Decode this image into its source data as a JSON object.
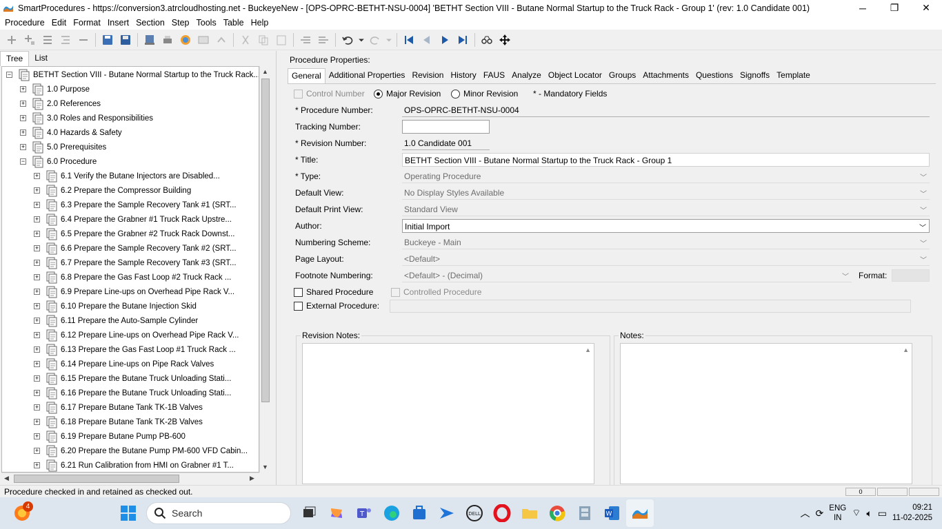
{
  "window": {
    "title": "SmartProcedures - https://conversion3.atrcloudhosting.net - BuckeyeNew - [OPS-OPRC-BETHT-NSU-0004] 'BETHT Section VIII - Butane Normal Startup to the Truck Rack - Group 1' (rev: 1.0 Candidate 001)"
  },
  "menu": [
    "Procedure",
    "Edit",
    "Format",
    "Insert",
    "Section",
    "Step",
    "Tools",
    "Table",
    "Help"
  ],
  "left_tabs": [
    "Tree",
    "List"
  ],
  "tree": {
    "root": "BETHT Section VIII - Butane Normal Startup to the Truck Rack...",
    "sections": [
      {
        "label": "1.0 Purpose",
        "expander": "+"
      },
      {
        "label": "2.0 References",
        "expander": "+"
      },
      {
        "label": "3.0 Roles and Responsibilities",
        "expander": "+"
      },
      {
        "label": "4.0 Hazards & Safety",
        "expander": "+"
      },
      {
        "label": "5.0 Prerequisites",
        "expander": "+"
      },
      {
        "label": "6.0 Procedure",
        "expander": "−"
      }
    ],
    "steps": [
      "6.1 Verify the Butane Injectors are Disabled...",
      "6.2 Prepare the Compressor Building",
      "6.3 Prepare the Sample Recovery Tank #1 (SRT...",
      "6.4 Prepare the Grabner #1 Truck Rack Upstre...",
      "6.5 Prepare the Grabner #2 Truck Rack Downst...",
      "6.6 Prepare the Sample Recovery Tank #2 (SRT...",
      "6.7 Prepare the Sample Recovery Tank #3 (SRT...",
      "6.8 Prepare the Gas Fast Loop #2 Truck Rack ...",
      "6.9 Prepare Line-ups on Overhead Pipe Rack V...",
      "6.10 Prepare the Butane Injection Skid",
      "6.11 Prepare the Auto-Sample Cylinder",
      "6.12 Prepare Line-ups on Overhead Pipe Rack V...",
      "6.13 Prepare the Gas Fast Loop #1 Truck Rack ...",
      "6.14 Prepare Line-ups on Pipe Rack Valves",
      "6.15 Prepare the Butane Truck Unloading Stati...",
      "6.16 Prepare the Butane Truck Unloading Stati...",
      "6.17 Prepare Butane Tank TK-1B Valves",
      "6.18 Prepare Butane Tank TK-2B Valves",
      "6.19 Prepare Butane Pump PB-600",
      "6.20 Prepare the Butane Pump PM-600 VFD Cabin...",
      "6.21 Run Calibration from HMI on Grabner #1 T..."
    ],
    "step_expander": "+"
  },
  "props": {
    "header": "Procedure Properties:",
    "tabs": [
      "General",
      "Additional Properties",
      "Revision",
      "History",
      "FAUS",
      "Analyze",
      "Object Locator",
      "Groups",
      "Attachments",
      "Questions",
      "Signoffs",
      "Template"
    ],
    "control_number_label": "Control Number",
    "major_revision_label": "Major Revision",
    "minor_revision_label": "Minor Revision",
    "mandatory_note": "* - Mandatory Fields",
    "fields": {
      "procedure_number_label": "* Procedure Number:",
      "procedure_number": "OPS-OPRC-BETHT-NSU-0004",
      "tracking_number_label": "Tracking Number:",
      "tracking_number": "",
      "revision_number_label": "* Revision Number:",
      "revision_number": "1.0 Candidate 001",
      "title_label": "* Title:",
      "title": "BETHT Section VIII - Butane Normal Startup to the Truck Rack - Group 1",
      "type_label": "* Type:",
      "type": "Operating Procedure",
      "default_view_label": "Default View:",
      "default_view": "No Display Styles Available",
      "default_print_view_label": "Default Print View:",
      "default_print_view": "Standard View",
      "author_label": "Author:",
      "author": "Initial Import",
      "numbering_scheme_label": "Numbering Scheme:",
      "numbering_scheme": "Buckeye - Main",
      "page_layout_label": "Page Layout:",
      "page_layout": "<Default>",
      "footnote_numbering_label": "Footnote Numbering:",
      "footnote_numbering": "<Default> - (Decimal)",
      "format_label": "Format:",
      "shared_procedure_label": "Shared Procedure",
      "controlled_procedure_label": "Controlled Procedure",
      "external_procedure_label": "External Procedure:"
    },
    "revision_notes_label": "Revision Notes:",
    "notes_label": "Notes:"
  },
  "status": {
    "message": "Procedure checked in and retained as checked out.",
    "box_text": "0"
  },
  "taskbar": {
    "search_placeholder": "Search",
    "notification_count": "4",
    "lang_line1": "ENG",
    "lang_line2": "IN",
    "time": "09:21",
    "date": "11-02-2025"
  },
  "colors": {
    "accent": "#0e5fb5",
    "taskbar": "#dde5ee"
  }
}
